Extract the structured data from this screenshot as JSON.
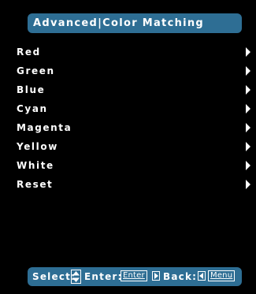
{
  "window": {
    "title": "Advanced|Color Matching"
  },
  "menu": {
    "items": [
      {
        "label": "Red",
        "icon": "chevron-right-icon"
      },
      {
        "label": "Green",
        "icon": "chevron-right-icon"
      },
      {
        "label": "Blue",
        "icon": "chevron-right-icon"
      },
      {
        "label": "Cyan",
        "icon": "chevron-right-icon"
      },
      {
        "label": "Magenta",
        "icon": "chevron-right-icon"
      },
      {
        "label": "Yellow",
        "icon": "chevron-right-icon"
      },
      {
        "label": "White",
        "icon": "chevron-right-icon"
      },
      {
        "label": "Reset",
        "icon": "chevron-right-icon"
      }
    ]
  },
  "footer": {
    "select_label": "Select:",
    "enter_label": "Enter:",
    "enter_key": "Enter",
    "back_label": "Back:",
    "menu_key": "Menu"
  },
  "colors": {
    "background": "#000000",
    "bar": "#2e6e94",
    "text": "#ffffff"
  }
}
